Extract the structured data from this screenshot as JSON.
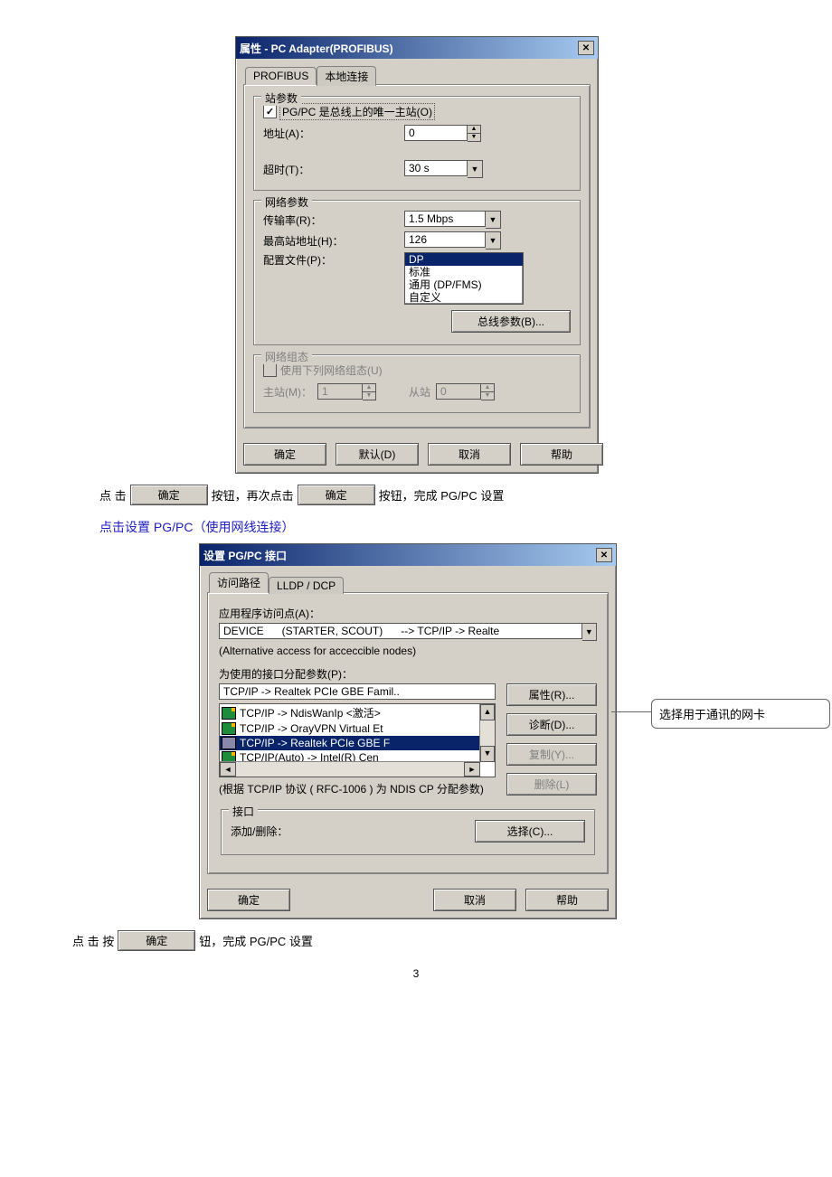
{
  "dialog1": {
    "title": "属性 - PC Adapter(PROFIBUS)",
    "tabs": {
      "profibus": "PROFIBUS",
      "local": "本地连接"
    },
    "station": {
      "group_title": "站参数",
      "only_master_label": "PG/PC 是总线上的唯一主站(O)",
      "only_master_checked": true,
      "address_label": "地址(A)：",
      "address_value": "0",
      "timeout_label": "超时(T)：",
      "timeout_value": "30 s"
    },
    "network": {
      "group_title": "网络参数",
      "rate_label": "传输率(R)：",
      "rate_value": "1.5 Mbps",
      "max_addr_label": "最高站地址(H)：",
      "max_addr_value": "126",
      "profile_label": "配置文件(P)：",
      "profiles": {
        "dp": "DP",
        "standard": "标准",
        "universal": "通用  (DP/FMS)",
        "custom": "自定义"
      },
      "bus_params_btn": "总线参数(B)..."
    },
    "netconfig": {
      "group_title": "网络组态",
      "use_following_label": "使用下列网络组态(U)",
      "use_following_checked": false,
      "master_label": "主站(M)：",
      "master_value": "1",
      "slave_label": "从站",
      "slave_value": "0"
    },
    "buttons": {
      "ok": "确定",
      "default": "默认(D)",
      "cancel": "取消",
      "help": "帮助"
    }
  },
  "instr1": {
    "click": "点 击",
    "btn1": "确定",
    "middle": "按钮，再次点击",
    "btn2": "确定",
    "end": "按钮，完成 PG/PC 设置"
  },
  "heading2": {
    "text": "点击设置 PG/PC",
    "paren": "（使用网线连接）"
  },
  "dialog2": {
    "title": "设置 PG/PC 接口",
    "tabs": {
      "path": "访问路径",
      "lldp": "LLDP / DCP"
    },
    "access_point_label": "应用程序访问点(A)：",
    "access_point_value": "DEVICE      (STARTER, SCOUT)      --> TCP/IP -> Realte",
    "alt_note": "(Alternative access for acceccible nodes)",
    "assign_label": "为使用的接口分配参数(P)：",
    "selected_box_value": "TCP/IP -> Realtek PCIe GBE Famil..",
    "interfaces": {
      "i1": "TCP/IP -> NdisWanIp  <激活>",
      "i2": "TCP/IP -> OrayVPN Virtual Et",
      "i3": "TCP/IP -> Realtek PCIe GBE F",
      "i4": "TCP/IP(Auto) -> Intel(R) Cen"
    },
    "note_below": "(根据 TCP/IP 协议 ( RFC-1006 )  为 NDIS CP 分配参数)",
    "side_buttons": {
      "props": "属性(R)...",
      "diag": "诊断(D)...",
      "copy": "复制(Y)...",
      "delete": "删除(L)"
    },
    "iface_group": {
      "title": "接口",
      "addremove": "添加/删除：",
      "select": "选择(C)..."
    },
    "buttons": {
      "ok": "确定",
      "cancel": "取消",
      "help": "帮助"
    }
  },
  "callout": "选择用于通讯的网卡",
  "instr2": {
    "click": "点 击 按",
    "btn": "确定",
    "end": "钮，完成 PG/PC 设置"
  },
  "page_number": "3"
}
